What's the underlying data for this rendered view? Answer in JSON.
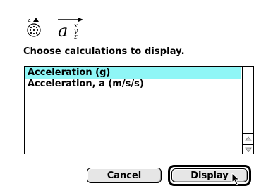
{
  "dialog": {
    "prompt": "Choose calculations to display.",
    "icons": [
      "sensor-icon",
      "vector-icon"
    ],
    "list": {
      "items": [
        {
          "label": "Acceleration (g)",
          "selected": true
        },
        {
          "label": "Acceleration, a (m/s/s)",
          "selected": false
        }
      ],
      "selection_color": "#8ff6f6"
    },
    "buttons": {
      "cancel_label": "Cancel",
      "display_label": "Display",
      "default": "display"
    }
  }
}
